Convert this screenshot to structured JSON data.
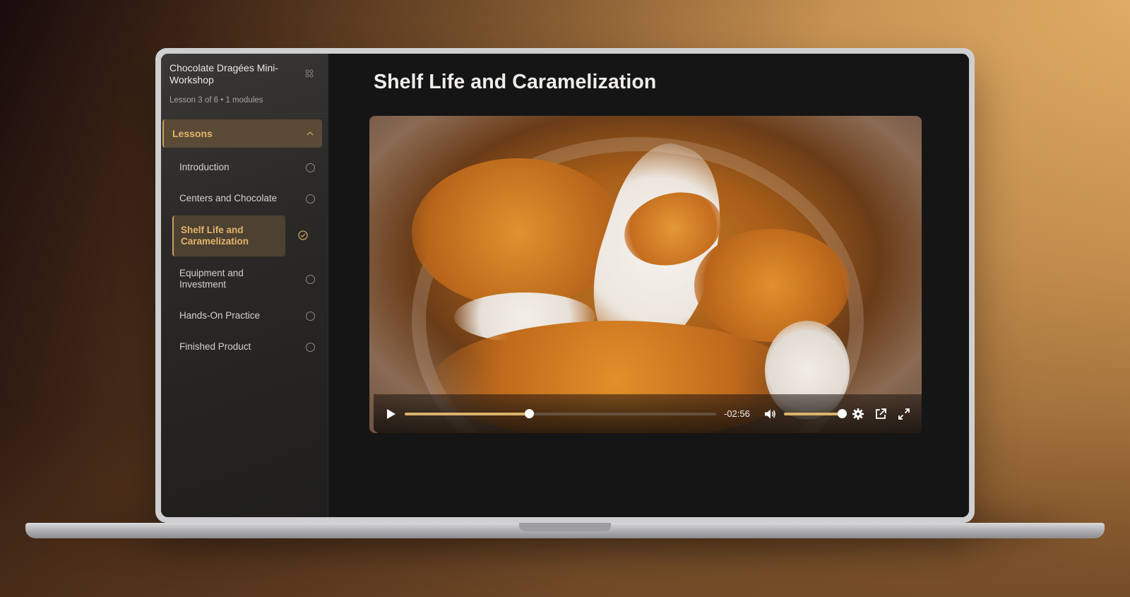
{
  "course": {
    "title": "Chocolate Dragées Mini-Workshop",
    "meta": "Lesson 3 of 6 • 1 modules"
  },
  "sidebar": {
    "section_label": "Lessons",
    "lessons": [
      {
        "label": "Introduction",
        "status": "incomplete"
      },
      {
        "label": "Centers and Chocolate",
        "status": "incomplete"
      },
      {
        "label": "Shelf Life and Caramelization",
        "status": "current"
      },
      {
        "label": "Equipment and Investment",
        "status": "incomplete"
      },
      {
        "label": "Hands-On Practice",
        "status": "incomplete"
      },
      {
        "label": "Finished Product",
        "status": "incomplete"
      }
    ]
  },
  "main": {
    "title": "Shelf Life and Caramelization"
  },
  "player": {
    "time_remaining": "-02:56",
    "progress_fraction": 0.4,
    "volume_fraction": 1.0
  },
  "colors": {
    "accent": "#d9b26b",
    "active_bg": "#4d4131"
  }
}
